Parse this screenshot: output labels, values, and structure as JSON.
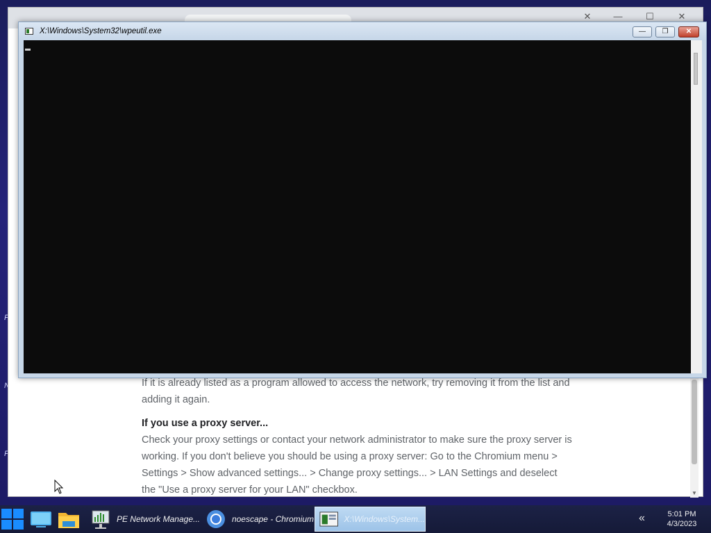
{
  "desktop": {
    "edge_letters": [
      "F",
      "N",
      "F"
    ]
  },
  "browser": {
    "controls": {
      "close": "✕",
      "minimize": "—",
      "maximize": "☐",
      "close2": "✕"
    },
    "content": {
      "para1": "If it is already listed as a program allowed to access the network, try removing it from the list and adding it again.",
      "heading": "If you use a proxy server...",
      "para2": "Check your proxy settings or contact your network administrator to make sure the proxy server is working. If you don't believe you should be using a proxy server: Go to the Chromium menu > Settings > Show advanced settings... > Change proxy settings... > LAN Settings and deselect the \"Use a proxy server for your LAN\" checkbox."
    }
  },
  "console": {
    "title": "X:\\Windows\\System32\\wpeutil.exe",
    "buttons": {
      "minimize": "—",
      "restore": "❐",
      "close": "✕"
    }
  },
  "taskbar": {
    "items": [
      {
        "label": "PE Network Manage...",
        "icon": "network-manager-icon"
      },
      {
        "label": "noescape - Chromium",
        "icon": "chromium-icon"
      },
      {
        "label": "X:\\Windows\\System...",
        "icon": "console-icon"
      }
    ],
    "tray_chevron": "«",
    "clock": {
      "time": "5:01 PM",
      "date": "4/3/2023"
    }
  },
  "colors": {
    "accent": "#1a8cff",
    "console_bg": "#0c0c0c",
    "desktop_bg": "#1e1f66"
  }
}
